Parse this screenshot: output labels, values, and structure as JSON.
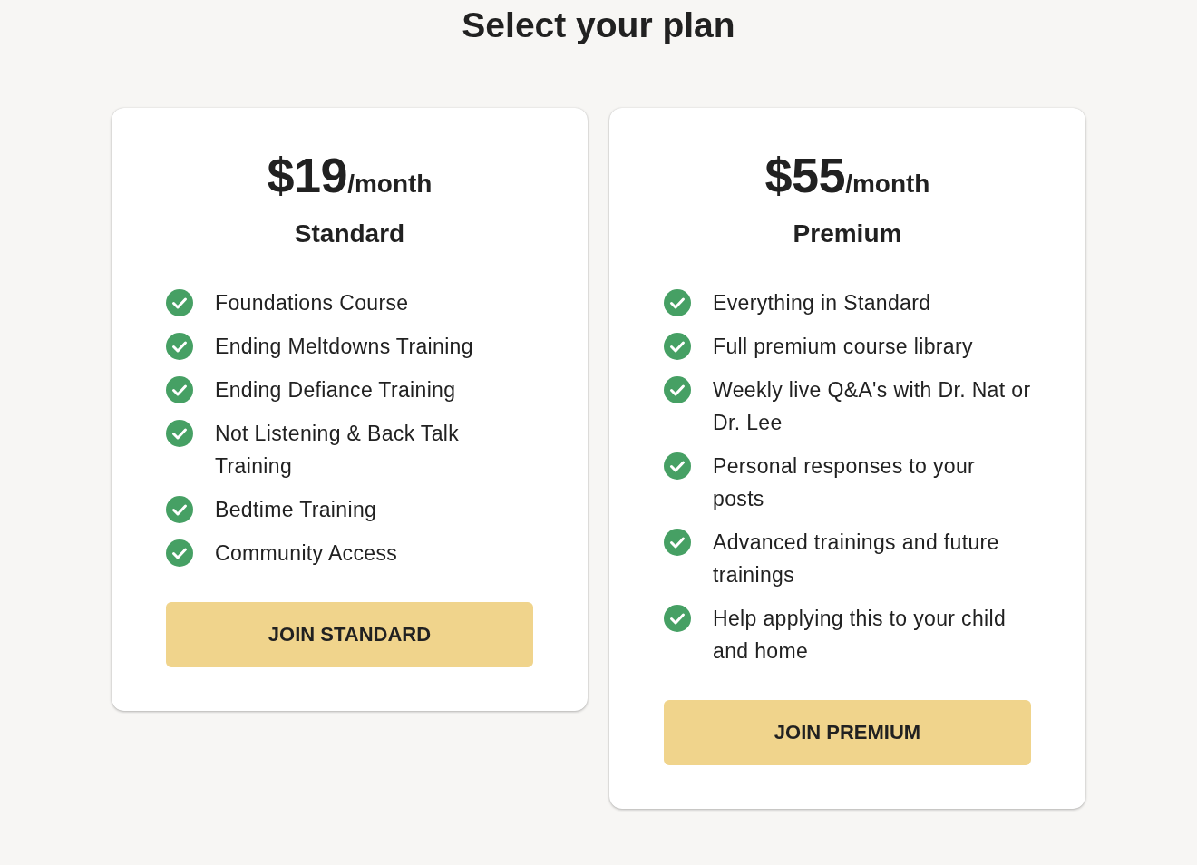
{
  "title": "Select your plan",
  "plans": [
    {
      "price": "$19",
      "period": "/month",
      "name": "Standard",
      "features": [
        "Foundations Course",
        "Ending Meltdowns Training",
        "Ending Defiance Training",
        "Not Listening & Back Talk Training",
        "Bedtime Training",
        "Community Access"
      ],
      "button": "JOIN STANDARD"
    },
    {
      "price": "$55",
      "period": "/month",
      "name": "Premium",
      "features": [
        "Everything in Standard",
        "Full premium course library",
        "Weekly live Q&A's with Dr. Nat or Dr. Lee",
        "Personal responses to your posts",
        "Advanced trainings and future trainings",
        "Help applying this to your child and home"
      ],
      "button": "JOIN PREMIUM"
    }
  ]
}
